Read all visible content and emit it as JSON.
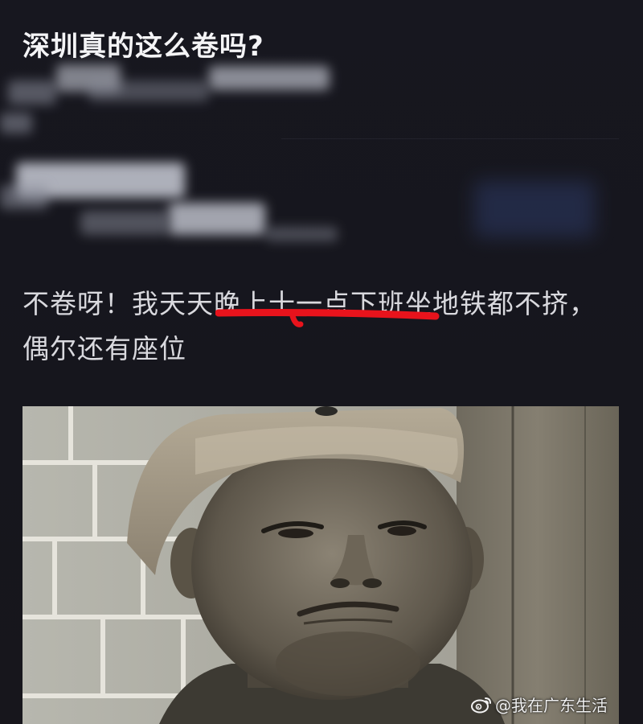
{
  "post": {
    "title": "深圳真的这么卷吗?"
  },
  "comment": {
    "text": "不卷呀！我天天晚上十一点下班坐地铁都不挤，偶尔还有座位"
  },
  "watermark": {
    "icon": "weibo-icon",
    "text": "@我在广东生活"
  },
  "colors": {
    "background": "#16161e",
    "title": "#f4f4f6",
    "comment": "#d9d9de",
    "underline": "#e8131c"
  }
}
